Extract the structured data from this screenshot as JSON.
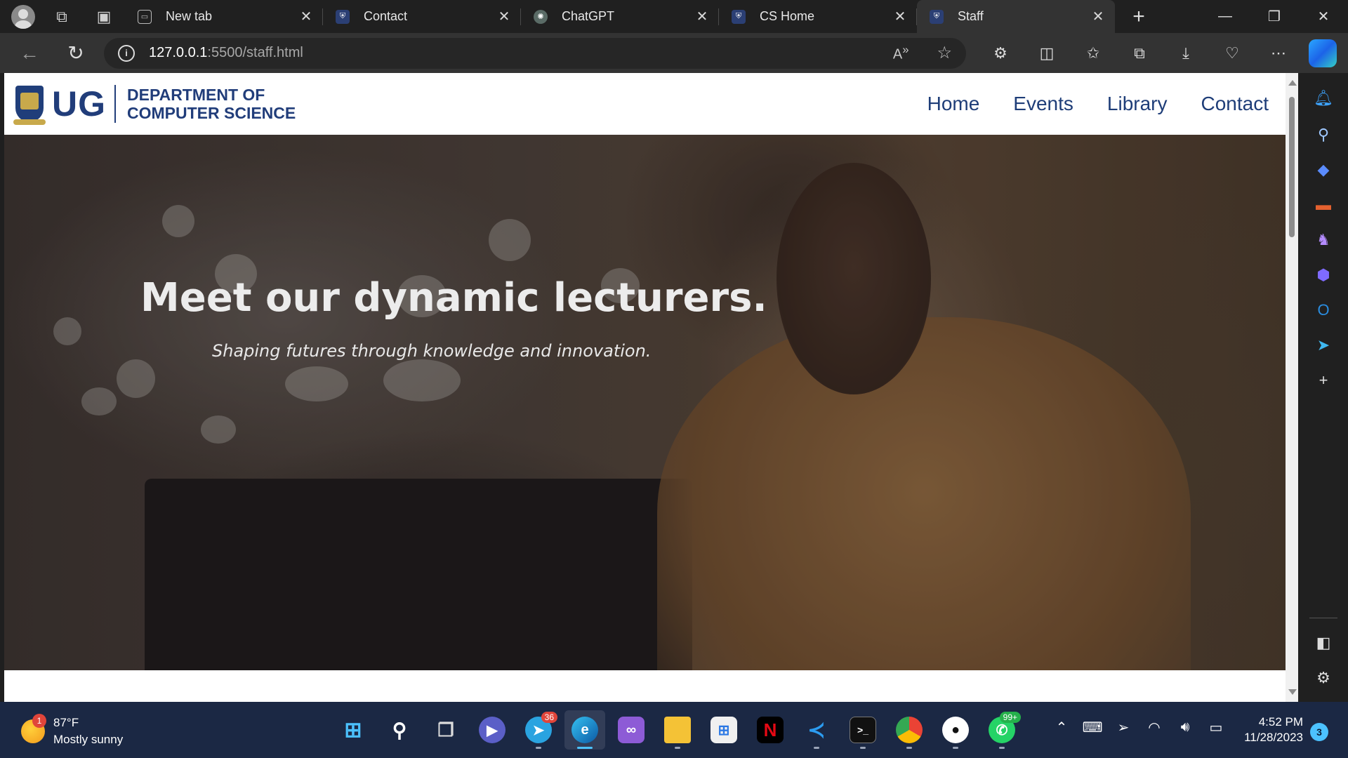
{
  "browser": {
    "tabs": [
      {
        "title": "New tab",
        "active": false
      },
      {
        "title": "Contact",
        "active": false
      },
      {
        "title": "ChatGPT",
        "active": false
      },
      {
        "title": "CS Home",
        "active": false
      },
      {
        "title": "Staff",
        "active": true
      }
    ],
    "url_host": "127.0.0.1",
    "url_path": ":5500/staff.html"
  },
  "site": {
    "logo_text": "UG",
    "dept_line1": "DEPARTMENT OF",
    "dept_line2": "COMPUTER SCIENCE",
    "nav": [
      "Home",
      "Events",
      "Library",
      "Contact"
    ],
    "brand_color": "#213d7a"
  },
  "hero": {
    "heading": "Meet our dynamic lecturers.",
    "subheading": "Shaping futures through knowledge and innovation."
  },
  "taskbar": {
    "weather_temp": "87°F",
    "weather_desc": "Mostly sunny",
    "weather_badge": "1",
    "apps": [
      {
        "name": "start",
        "badge": ""
      },
      {
        "name": "search",
        "badge": ""
      },
      {
        "name": "task-view",
        "badge": ""
      },
      {
        "name": "teams-chat",
        "badge": ""
      },
      {
        "name": "telegram",
        "badge": "36"
      },
      {
        "name": "edge",
        "badge": ""
      },
      {
        "name": "visual-studio-preview",
        "badge": ""
      },
      {
        "name": "file-explorer",
        "badge": ""
      },
      {
        "name": "microsoft-store",
        "badge": ""
      },
      {
        "name": "netflix",
        "badge": ""
      },
      {
        "name": "vscode",
        "badge": ""
      },
      {
        "name": "terminal",
        "badge": ""
      },
      {
        "name": "chrome",
        "badge": ""
      },
      {
        "name": "github",
        "badge": ""
      },
      {
        "name": "whatsapp",
        "badge": "99+"
      }
    ],
    "time": "4:52 PM",
    "date": "11/28/2023",
    "notifications": "3"
  }
}
